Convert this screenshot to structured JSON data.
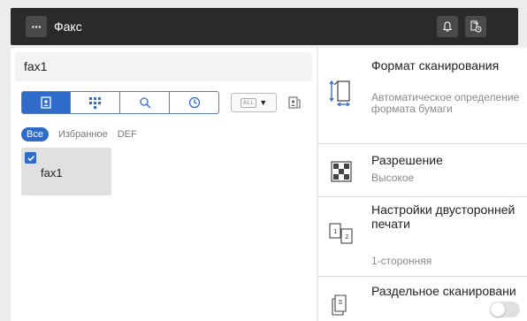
{
  "header": {
    "menu_glyph": "···",
    "title": "Факс"
  },
  "left": {
    "destination_value": "fax1",
    "all_label": "ALL",
    "filters": [
      "Все",
      "Избранное",
      "DEF"
    ],
    "destinations": [
      {
        "name": "fax1",
        "selected": true
      }
    ]
  },
  "settings": {
    "scan_size_label": "Формат сканирования",
    "scan_size_value": "Автоматическое определение формата бумаги",
    "resolution_label": "Разрешение",
    "resolution_value": "Высокое",
    "duplex_label": "Настройки двусторонней печати",
    "duplex_value": "1-сторонняя",
    "separate_scan_label": "Раздельное сканировани",
    "separate_scan_on": false
  },
  "colors": {
    "accent": "#2f6bc9",
    "topbar": "#2a2a2a"
  }
}
